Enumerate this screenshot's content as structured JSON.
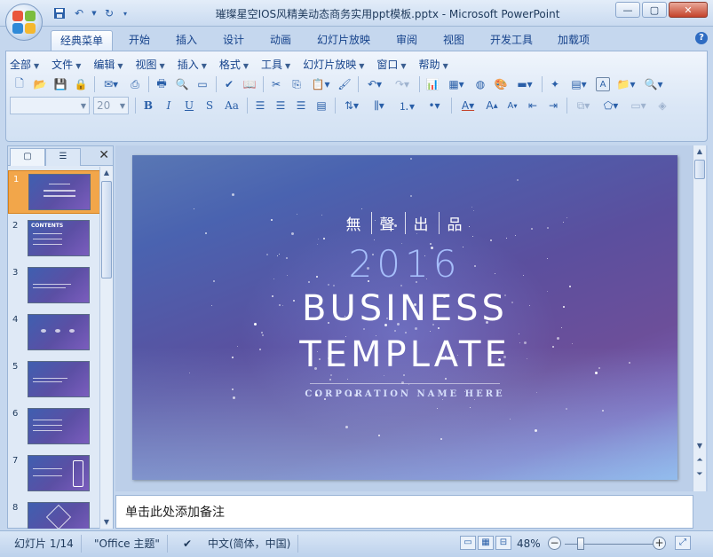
{
  "window": {
    "title": "璀璨星空IOS风精美动态商务实用ppt模板.pptx - Microsoft PowerPoint",
    "minimize": "—",
    "maximize": "▢",
    "close": "✕"
  },
  "qat": {
    "save_icon": "save-icon",
    "undo_icon": "undo-icon",
    "redo_icon": "redo-icon"
  },
  "tabs": [
    {
      "label": "经典菜单",
      "active": true
    },
    {
      "label": "开始"
    },
    {
      "label": "插入"
    },
    {
      "label": "设计"
    },
    {
      "label": "动画"
    },
    {
      "label": "幻灯片放映"
    },
    {
      "label": "审阅"
    },
    {
      "label": "视图"
    },
    {
      "label": "开发工具"
    },
    {
      "label": "加载项"
    }
  ],
  "menus": [
    "全部",
    "文件",
    "编辑",
    "视图",
    "插入",
    "格式",
    "工具",
    "幻灯片放映",
    "窗口",
    "帮助"
  ],
  "format": {
    "font_name": "",
    "font_size": "20",
    "bold": "B",
    "italic": "I",
    "underline": "U",
    "shadow": "S",
    "case": "Aa"
  },
  "slide_pane": {
    "close": "✕",
    "thumbnails": [
      {
        "num": "1",
        "selected": true
      },
      {
        "num": "2",
        "label": "CONTENTS"
      },
      {
        "num": "3"
      },
      {
        "num": "4"
      },
      {
        "num": "5"
      },
      {
        "num": "6"
      },
      {
        "num": "7"
      },
      {
        "num": "8"
      }
    ]
  },
  "slide": {
    "kanji": [
      "無",
      "聲",
      "出",
      "品"
    ],
    "year": "2016",
    "title_line1": "BUSINESS",
    "title_line2": "TEMPLATE",
    "corporation": "CORPORATION NAME HERE"
  },
  "notes": {
    "placeholder": "单击此处添加备注"
  },
  "status": {
    "slide_counter": "幻灯片 1/14",
    "theme": "\"Office 主题\"",
    "language": "中文(简体，中国)",
    "zoom": "48%",
    "zoom_level": 0.48
  },
  "colors": {
    "ribbon_bg": "#dbe7f6",
    "selected_thumb": "#f2a64a",
    "close_button": "#c4432b"
  }
}
